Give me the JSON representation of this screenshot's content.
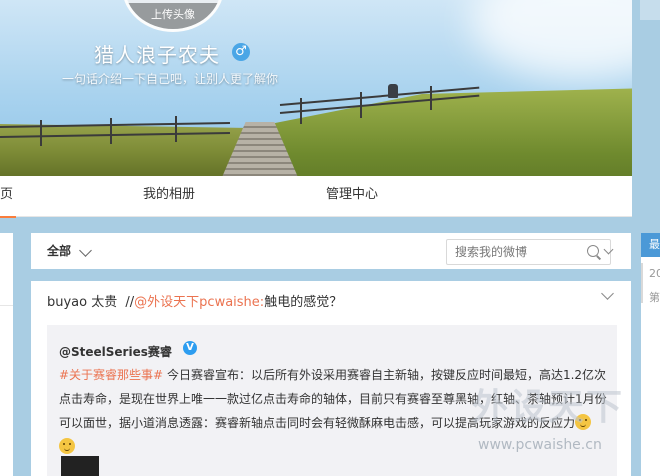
{
  "profile": {
    "avatar_label": "上传头像",
    "nickname": "猎人浪子农夫",
    "gender_symbol": "♂",
    "intro": "一句话介绍一下自己吧，让别人更了解你"
  },
  "tabs": [
    {
      "label": "页"
    },
    {
      "label": "我的相册"
    },
    {
      "label": "管理中心"
    }
  ],
  "filter": {
    "all_label": "全部",
    "search_placeholder": "搜索我的微博"
  },
  "post": {
    "author": "buyao",
    "author_suffix": "太贵",
    "separator": "//",
    "mention": "@外设天下pcwaishe:",
    "text": "触电的感觉？",
    "repost": {
      "user": "@SteelSeries赛睿",
      "verified": "V",
      "tag": "#关于赛睿那些事#",
      "text": "今日赛睿宣布：以后所有外设采用赛睿自主新轴，按键反应时间最短，高达1.2亿次点击寿命，是现在世界上唯一一款过亿点击寿命的轴体，目前只有赛睿至尊黑轴，红轴、茶轴预计1月份可以面世，据小道消息透露：赛睿新轴点击同时会有轻微酥麻电击感，可以提高玩家游戏的反应力"
    }
  },
  "right_panel": {
    "head": "最",
    "year": "20",
    "small": "第"
  },
  "watermark": {
    "big": "外设天下",
    "url": "www.pcwaishe.cn"
  }
}
